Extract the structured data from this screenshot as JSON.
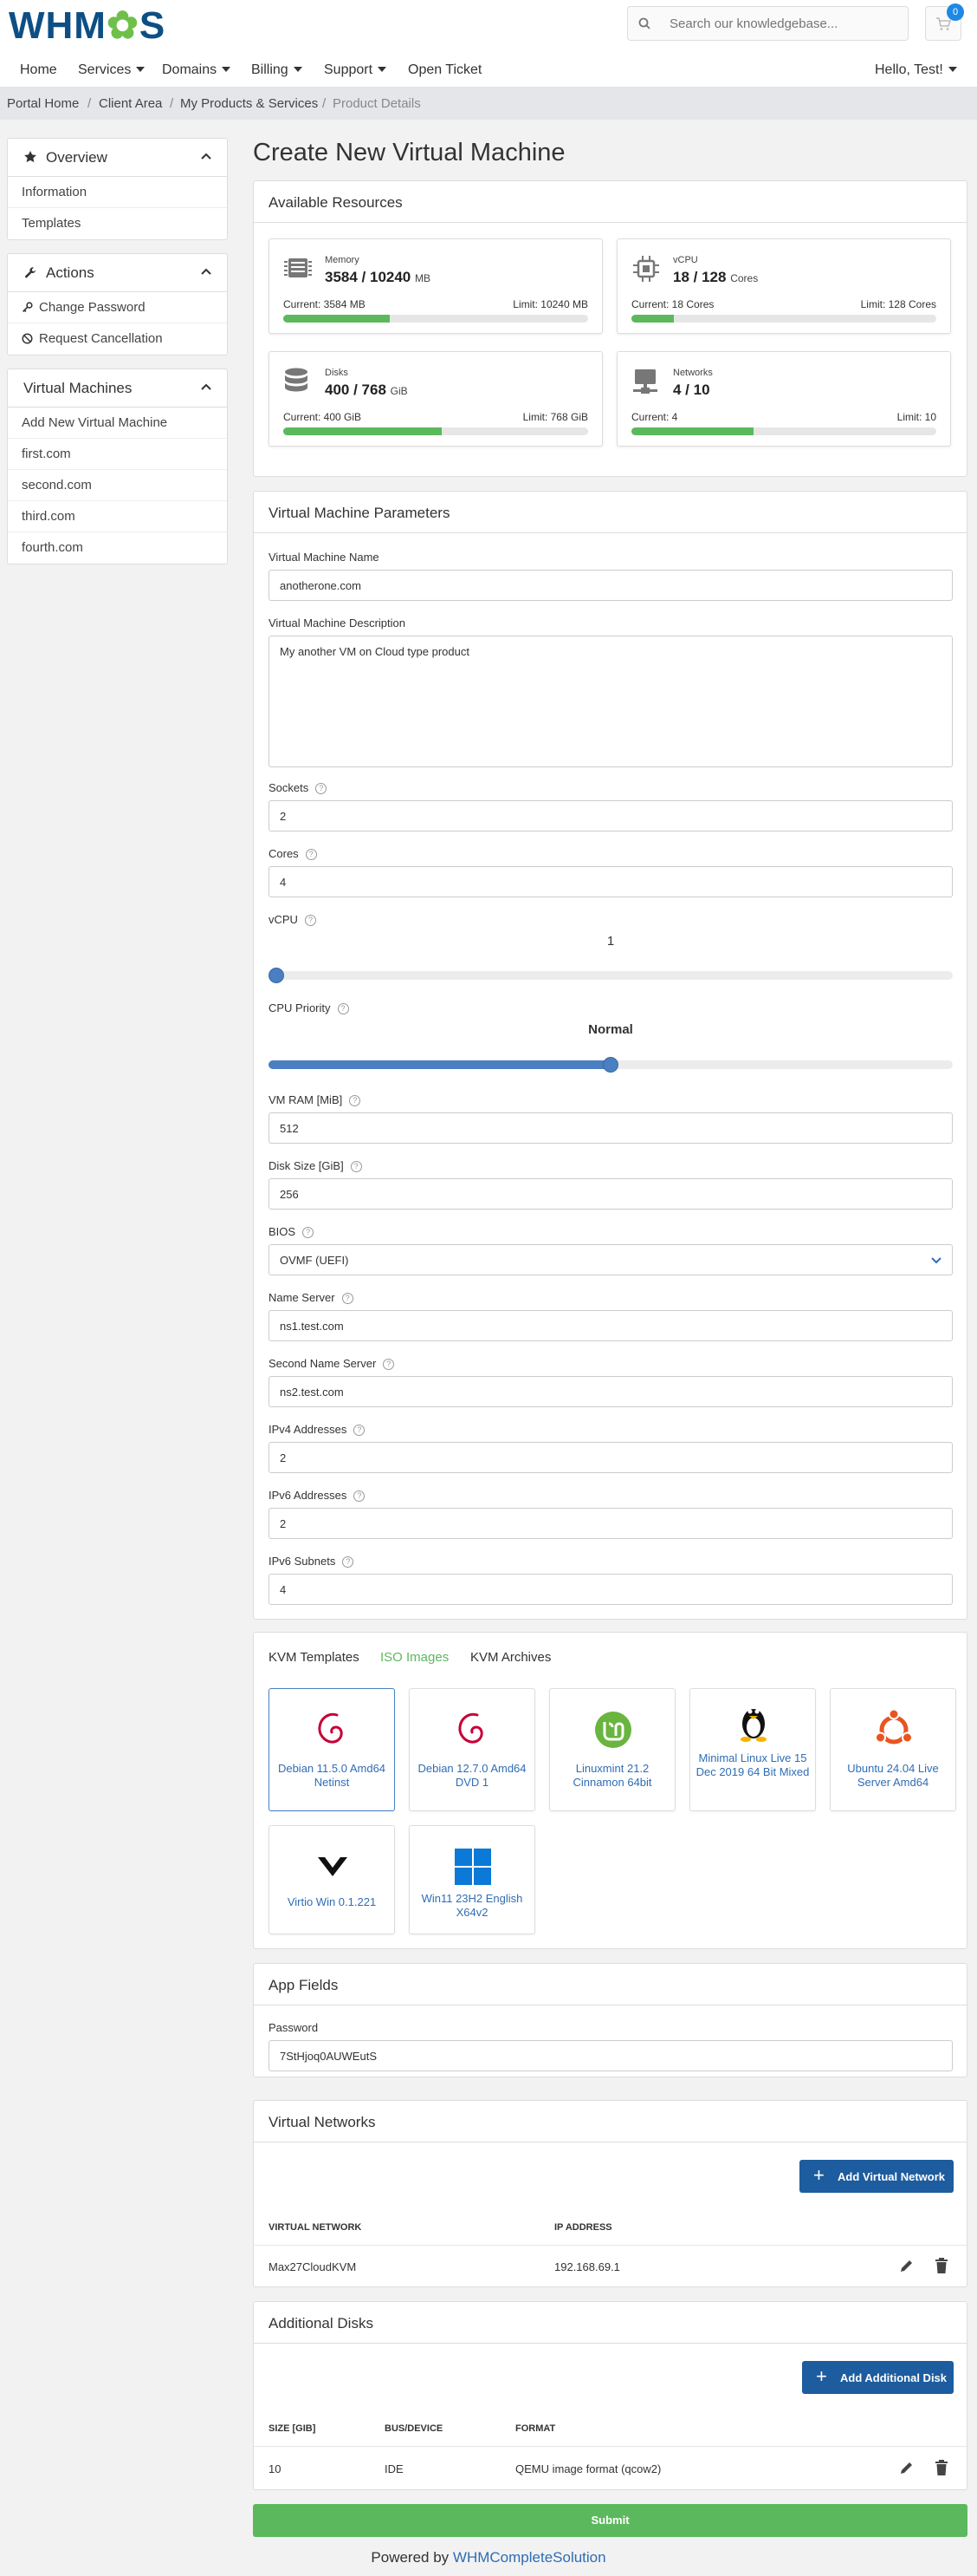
{
  "header": {
    "logo_text": "WHMCS",
    "search_placeholder": "Search our knowledgebase...",
    "cart_count": "0"
  },
  "nav": {
    "items": [
      "Home",
      "Services",
      "Domains",
      "Billing",
      "Support",
      "Open Ticket"
    ],
    "user": "Hello, Test!"
  },
  "breadcrumb": [
    "Portal Home",
    "Client Area",
    "My Products & Services",
    "Product Details"
  ],
  "sidebar": {
    "overview": {
      "title": "Overview",
      "items": [
        "Information",
        "Templates"
      ]
    },
    "actions": {
      "title": "Actions",
      "items": [
        "Change Password",
        "Request Cancellation"
      ]
    },
    "vms": {
      "title": "Virtual Machines",
      "items": [
        "Add New Virtual Machine",
        "first.com",
        "second.com",
        "third.com",
        "fourth.com"
      ]
    }
  },
  "page_title": "Create New Virtual Machine",
  "resources": {
    "title": "Available Resources",
    "memory": {
      "label": "Memory",
      "value": "3584 / 10240",
      "unit": "MB",
      "current": "Current: 3584 MB",
      "limit": "Limit: 10240 MB",
      "ratio": 0.35
    },
    "vcpu": {
      "label": "vCPU",
      "value": "18 / 128",
      "unit": "Cores",
      "current": "Current: 18 Cores",
      "limit": "Limit: 128 Cores",
      "ratio": 0.14
    },
    "disks": {
      "label": "Disks",
      "value": "400 / 768",
      "unit": "GiB",
      "current": "Current: 400 GiB",
      "limit": "Limit: 768 GiB",
      "ratio": 0.52
    },
    "networks": {
      "label": "Networks",
      "value": "4 / 10",
      "unit": "",
      "current": "Current: 4",
      "limit": "Limit: 10",
      "ratio": 0.4
    }
  },
  "params": {
    "title": "Virtual Machine Parameters",
    "vm_name_label": "Virtual Machine Name",
    "vm_name": "anotherone.com",
    "vm_desc_label": "Virtual Machine Description",
    "vm_desc": "My another VM on Cloud type product",
    "sockets_label": "Sockets",
    "sockets": "2",
    "cores_label": "Cores",
    "cores": "4",
    "vcpu_label": "vCPU",
    "vcpu_value": "1",
    "vcpu_ratio": 0,
    "cpu_priority_label": "CPU Priority",
    "cpu_priority_value": "Normal",
    "cpu_priority_ratio": 0.5,
    "vm_ram_label": "VM RAM [MiB]",
    "vm_ram": "512",
    "disk_size_label": "Disk Size [GiB]",
    "disk_size": "256",
    "bios_label": "BIOS",
    "bios": "OVMF (UEFI)",
    "ns1_label": "Name Server",
    "ns1": "ns1.test.com",
    "ns2_label": "Second Name Server",
    "ns2": "ns2.test.com",
    "ipv4_label": "IPv4 Addresses",
    "ipv4": "2",
    "ipv6_label": "IPv6 Addresses",
    "ipv6": "2",
    "ipv6_subnets_label": "IPv6 Subnets",
    "ipv6_subnets": "4"
  },
  "images": {
    "tabs": [
      "KVM Templates",
      "ISO Images",
      "KVM Archives"
    ],
    "active_tab": "ISO Images",
    "items": [
      {
        "name": "Debian 11.5.0 Amd64 Netinst",
        "icon": "debian-icon",
        "selected": true
      },
      {
        "name": "Debian 12.7.0 Amd64 DVD 1",
        "icon": "debian-icon",
        "selected": false
      },
      {
        "name": "Linuxmint 21.2 Cinnamon 64bit",
        "icon": "linuxmint-icon",
        "selected": false
      },
      {
        "name": "Minimal Linux Live 15 Dec 2019 64 Bit Mixed",
        "icon": "tux-icon",
        "selected": false
      },
      {
        "name": "Ubuntu 24.04 Live Server Amd64",
        "icon": "ubuntu-icon",
        "selected": false
      },
      {
        "name": "Virtio Win 0.1.221",
        "icon": "virtio-icon",
        "selected": false
      },
      {
        "name": "Win11 23H2 English X64v2",
        "icon": "windows-icon",
        "selected": false
      }
    ]
  },
  "app_fields": {
    "title": "App Fields",
    "password_label": "Password",
    "password": "7StHjoq0AUWEutS"
  },
  "networks": {
    "title": "Virtual Networks",
    "add_label": "Add Virtual Network",
    "columns": [
      "VIRTUAL NETWORK",
      "IP ADDRESS"
    ],
    "rows": [
      {
        "network": "Max27CloudKVM",
        "ip": "192.168.69.1"
      }
    ]
  },
  "disks": {
    "title": "Additional Disks",
    "add_label": "Add Additional Disk",
    "columns": [
      "SIZE [GIB]",
      "BUS/DEVICE",
      "FORMAT"
    ],
    "rows": [
      {
        "size": "10",
        "bus": "IDE",
        "format": "QEMU image format (qcow2)"
      }
    ]
  },
  "submit_label": "Submit",
  "footer": {
    "prefix": "Powered by ",
    "link": "WHMCompleteSolution"
  },
  "colors": {
    "brand": "#0d4f84",
    "accent": "#4a7fc1",
    "success": "#5cb85c",
    "link": "#2f6db5"
  }
}
